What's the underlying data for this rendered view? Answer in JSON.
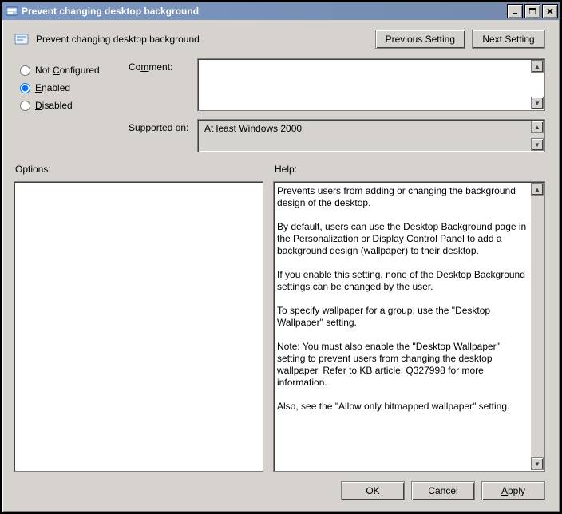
{
  "window": {
    "title": "Prevent changing desktop background"
  },
  "header": {
    "policy_name": "Prevent changing desktop background",
    "prev_btn_pre": "",
    "prev_btn_u": "P",
    "prev_btn_post": "revious Setting",
    "next_btn_pre": "",
    "next_btn_u": "N",
    "next_btn_post": "ext Setting"
  },
  "state": {
    "not_configured_pre": "Not ",
    "not_configured_u": "C",
    "not_configured_post": "onfigured",
    "enabled_pre": "",
    "enabled_u": "E",
    "enabled_post": "nabled",
    "disabled_pre": "",
    "disabled_u": "D",
    "disabled_post": "isabled",
    "selected": "enabled"
  },
  "fields": {
    "comment_label_pre": "Co",
    "comment_label_u": "m",
    "comment_label_post": "ment:",
    "comment_value": "",
    "supported_label": "Supported on:",
    "supported_value": "At least Windows 2000"
  },
  "panels": {
    "options_label": "Options:",
    "help_label": "Help:",
    "help_text": "Prevents users from adding or changing the background design of the desktop.\n\nBy default, users can use the Desktop Background page in the Personalization or Display Control Panel to add a background design (wallpaper) to their desktop.\n\nIf you enable this setting, none of the Desktop Background settings can be changed by the user.\n\nTo specify wallpaper for a group, use the \"Desktop Wallpaper\" setting.\n\nNote: You must also enable the \"Desktop Wallpaper\" setting to prevent users from changing the desktop wallpaper. Refer to KB article: Q327998 for more information.\n\nAlso, see the \"Allow only bitmapped wallpaper\" setting."
  },
  "footer": {
    "ok": "OK",
    "cancel": "Cancel",
    "apply_pre": "",
    "apply_u": "A",
    "apply_post": "pply"
  }
}
